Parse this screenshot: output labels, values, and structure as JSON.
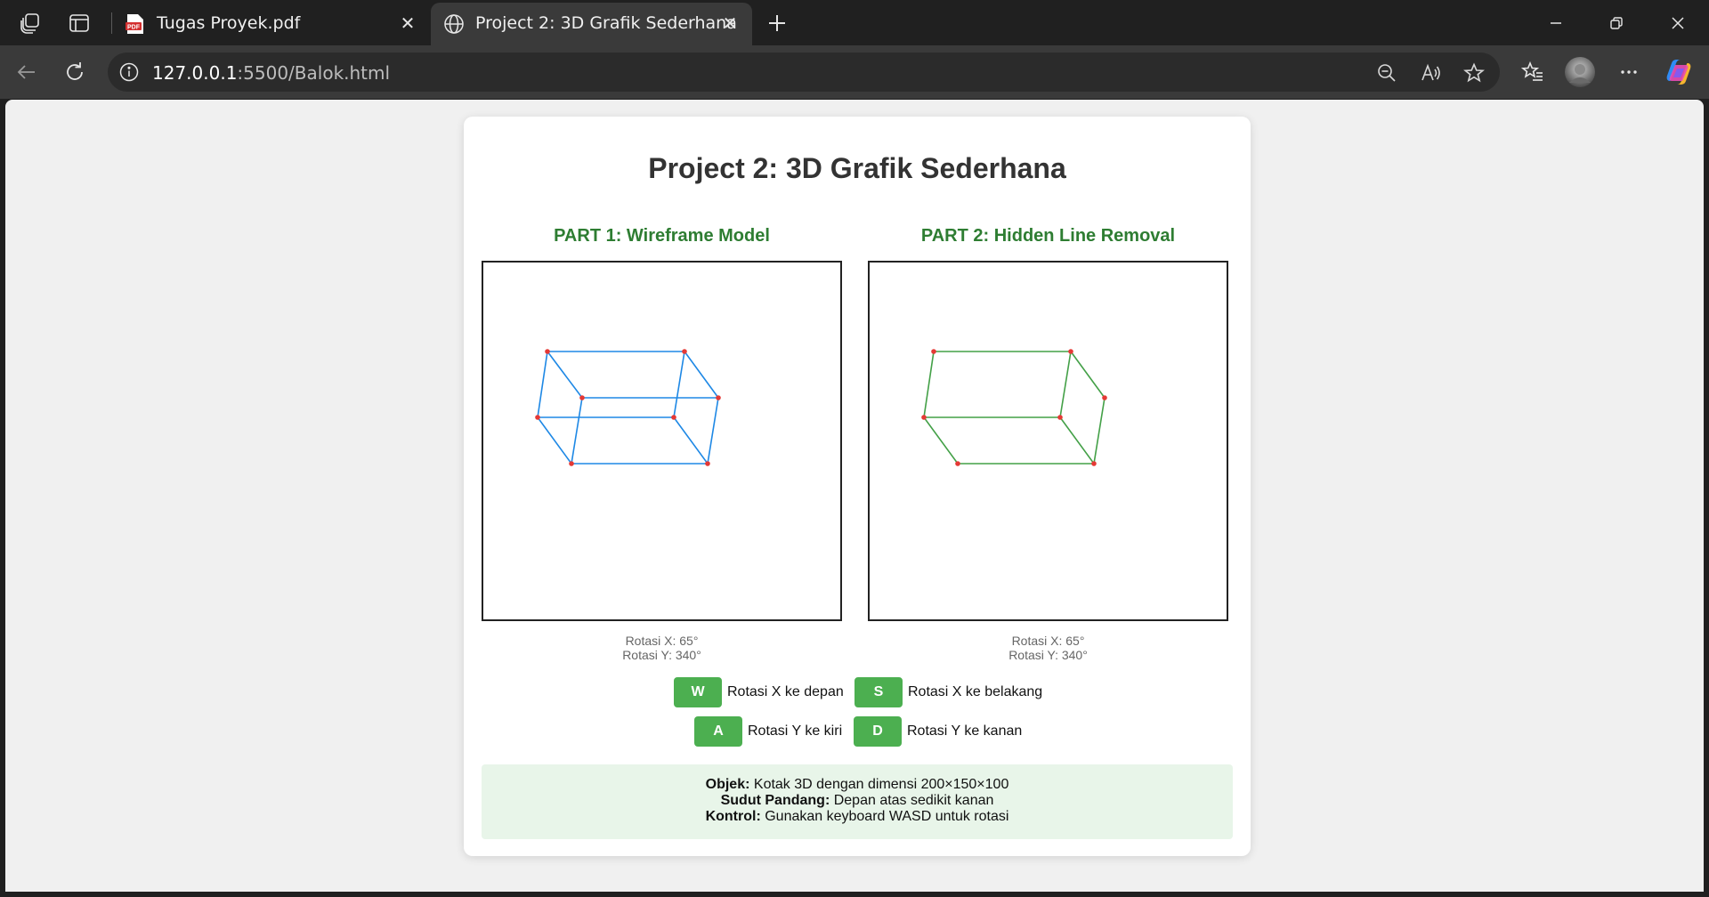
{
  "browser": {
    "tabs": [
      {
        "title": "Tugas Proyek.pdf",
        "icon": "pdf-icon",
        "active": false
      },
      {
        "title": "Project 2: 3D Grafik Sederhana",
        "icon": "globe-icon",
        "active": true
      }
    ],
    "url_host": "127.0.0.1",
    "url_rest": ":5500/Balok.html"
  },
  "page": {
    "title": "Project 2: 3D Grafik Sederhana",
    "part1_title": "PART 1: Wireframe Model",
    "part2_title": "PART 2: Hidden Line Removal",
    "part1_rot_x": "Rotasi X: 65°",
    "part1_rot_y": "Rotasi Y: 340°",
    "part2_rot_x": "Rotasi X: 65°",
    "part2_rot_y": "Rotasi Y: 340°",
    "controls": {
      "w_key": "W",
      "w_label": "Rotasi X ke depan",
      "s_key": "S",
      "s_label": "Rotasi X ke belakang",
      "a_key": "A",
      "a_label": "Rotasi Y ke kiri",
      "d_key": "D",
      "d_label": "Rotasi Y ke kanan"
    },
    "info": {
      "obj_label": "Objek:",
      "obj_text": "Kotak 3D dengan dimensi 200×150×100",
      "view_label": "Sudut Pandang:",
      "view_text": "Depan atas sedikit kanan",
      "ctrl_label": "Kontrol:",
      "ctrl_text": "Gunakan keyboard WASD untuk rotasi"
    }
  },
  "colors": {
    "wireframe": "#1e88e5",
    "hidden": "#43a047",
    "vertex": "#e53935",
    "accent": "#4caf50"
  }
}
